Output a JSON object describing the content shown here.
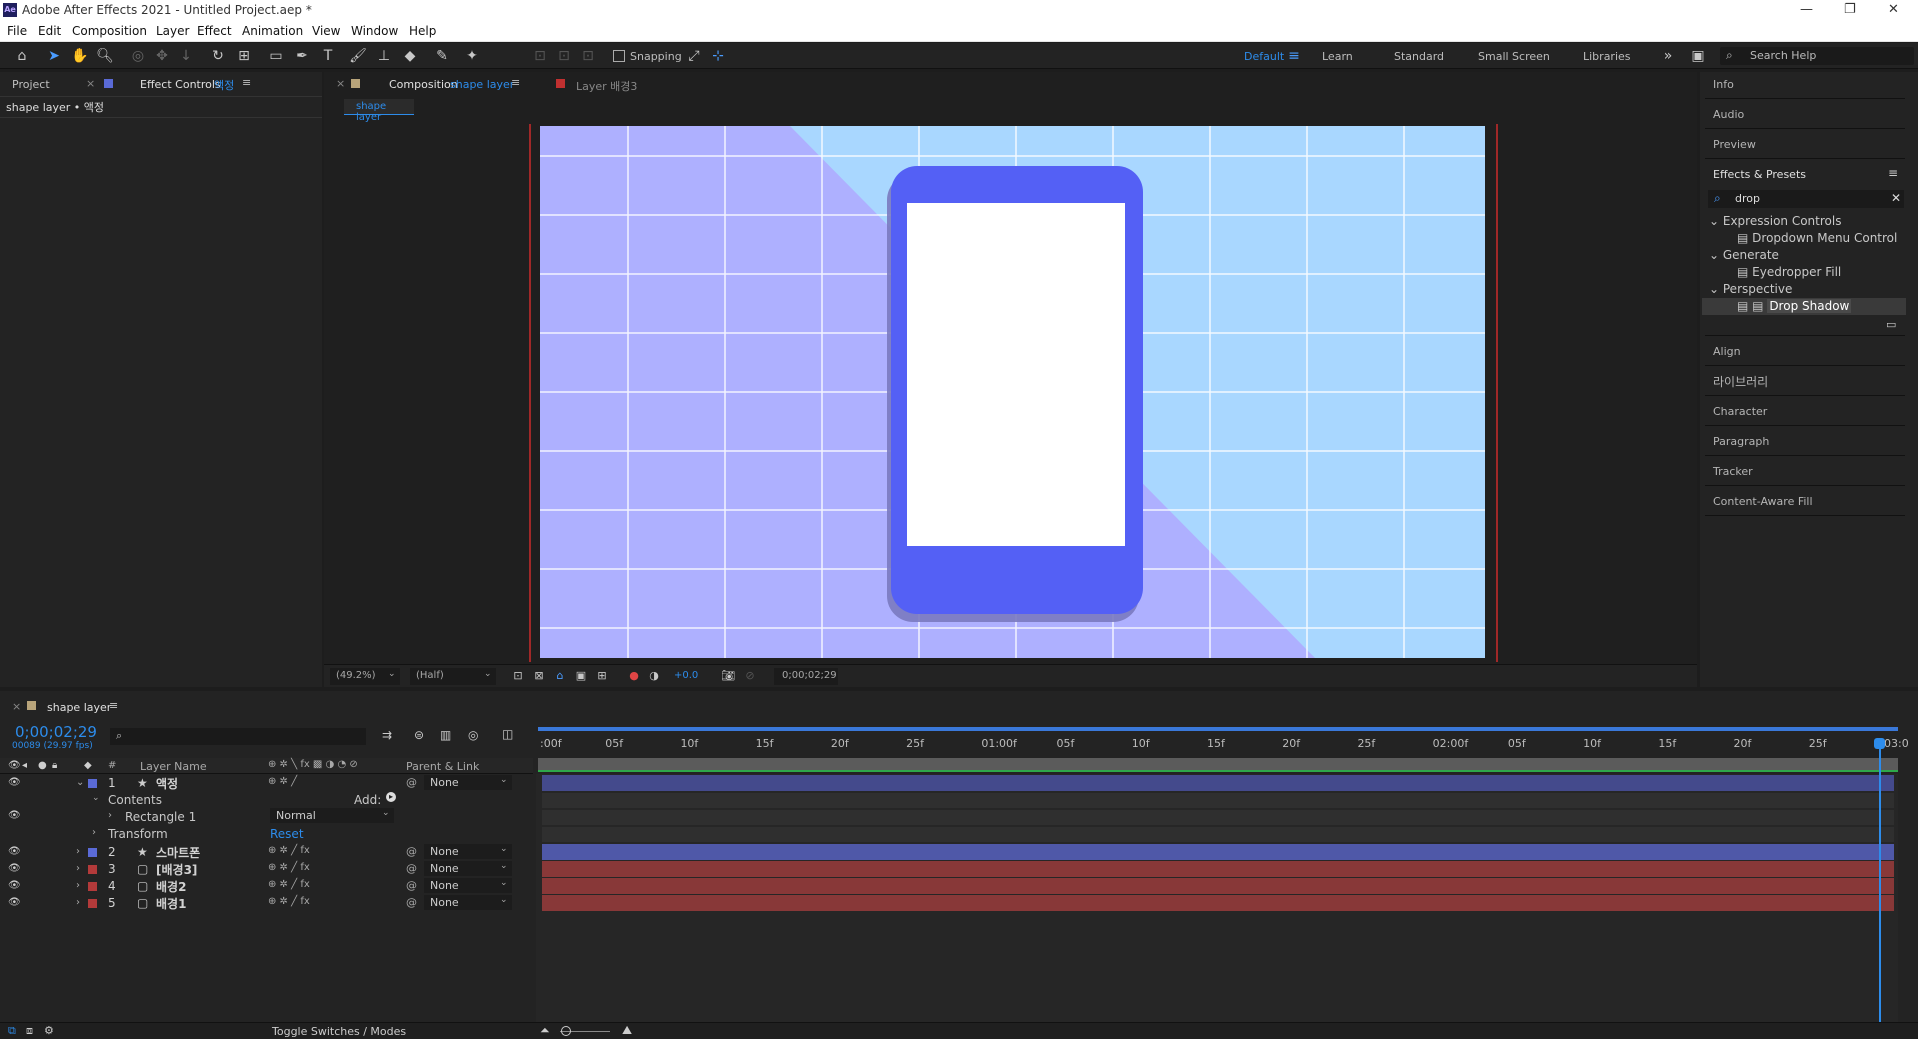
{
  "window": {
    "app_icon": "Ae",
    "title": "Adobe After Effects 2021 - Untitled Project.aep *",
    "controls": [
      "minimize-icon",
      "restore-icon",
      "close-icon"
    ]
  },
  "menu": [
    "File",
    "Edit",
    "Composition",
    "Layer",
    "Effect",
    "Animation",
    "View",
    "Window",
    "Help"
  ],
  "toolbar": {
    "snapping_label": "Snapping",
    "workspaces": [
      "Default",
      "Learn",
      "Standard",
      "Small Screen",
      "Libraries"
    ],
    "active_workspace": "Default",
    "search_help": "Search Help"
  },
  "left_panel": {
    "tab_project": "Project",
    "tab_effect_controls": "Effect Controls",
    "tab_effect_controls_layer": "액정",
    "subtitle": "shape layer • 액정"
  },
  "comp_panel": {
    "tab_label": "Composition",
    "tab_comp_name": "shape layer",
    "tab_layer": "Layer 배경3",
    "breadcrumb": "shape layer",
    "zoom": "(49.2%)",
    "resolution": "(Half)",
    "exposure": "+0.0",
    "timecode": "0;00;02;29"
  },
  "right_panel": {
    "items_top": [
      "Info",
      "Audio",
      "Preview"
    ],
    "effects_presets_title": "Effects & Presets",
    "search_value": "drop",
    "tree": [
      {
        "group": "Expression Controls",
        "items": [
          "Dropdown Menu Control"
        ]
      },
      {
        "group": "Generate",
        "items": [
          "Eyedropper Fill"
        ]
      },
      {
        "group": "Perspective",
        "items": [
          "Drop Shadow"
        ]
      }
    ],
    "items_bottom": [
      "Align",
      "라이브러리",
      "Character",
      "Paragraph",
      "Tracker",
      "Content-Aware Fill"
    ]
  },
  "timeline": {
    "tab": "shape layer",
    "timecode": "0;00;02;29",
    "frame_info": "00089 (29.97 fps)",
    "col_layer_name": "Layer Name",
    "col_parent": "Parent & Link",
    "col_num": "#",
    "ruler": [
      ":00f",
      "05f",
      "10f",
      "15f",
      "20f",
      "25f",
      "01:00f",
      "05f",
      "10f",
      "15f",
      "20f",
      "25f",
      "02:00f",
      "05f",
      "10f",
      "15f",
      "20f",
      "25f",
      "03:0"
    ],
    "layers": [
      {
        "num": "1",
        "name": "액정",
        "star": true,
        "color": "#5a6ad6",
        "parent": "None",
        "expanded": true
      },
      {
        "num": "2",
        "name": "스마트폰",
        "star": true,
        "color": "#5a6ad6",
        "parent": "None"
      },
      {
        "num": "3",
        "name": "[배경3]",
        "star": false,
        "color": "#b33a3a",
        "parent": "None"
      },
      {
        "num": "4",
        "name": "배경2",
        "star": false,
        "color": "#b33a3a",
        "parent": "None"
      },
      {
        "num": "5",
        "name": "배경1",
        "star": false,
        "color": "#b33a3a",
        "parent": "None"
      }
    ],
    "contents_label": "Contents",
    "add_label": "Add:",
    "rectangle_label": "Rectangle 1",
    "blend_mode": "Normal",
    "transform_label": "Transform",
    "reset_label": "Reset",
    "toggle_label": "Toggle Switches / Modes"
  }
}
